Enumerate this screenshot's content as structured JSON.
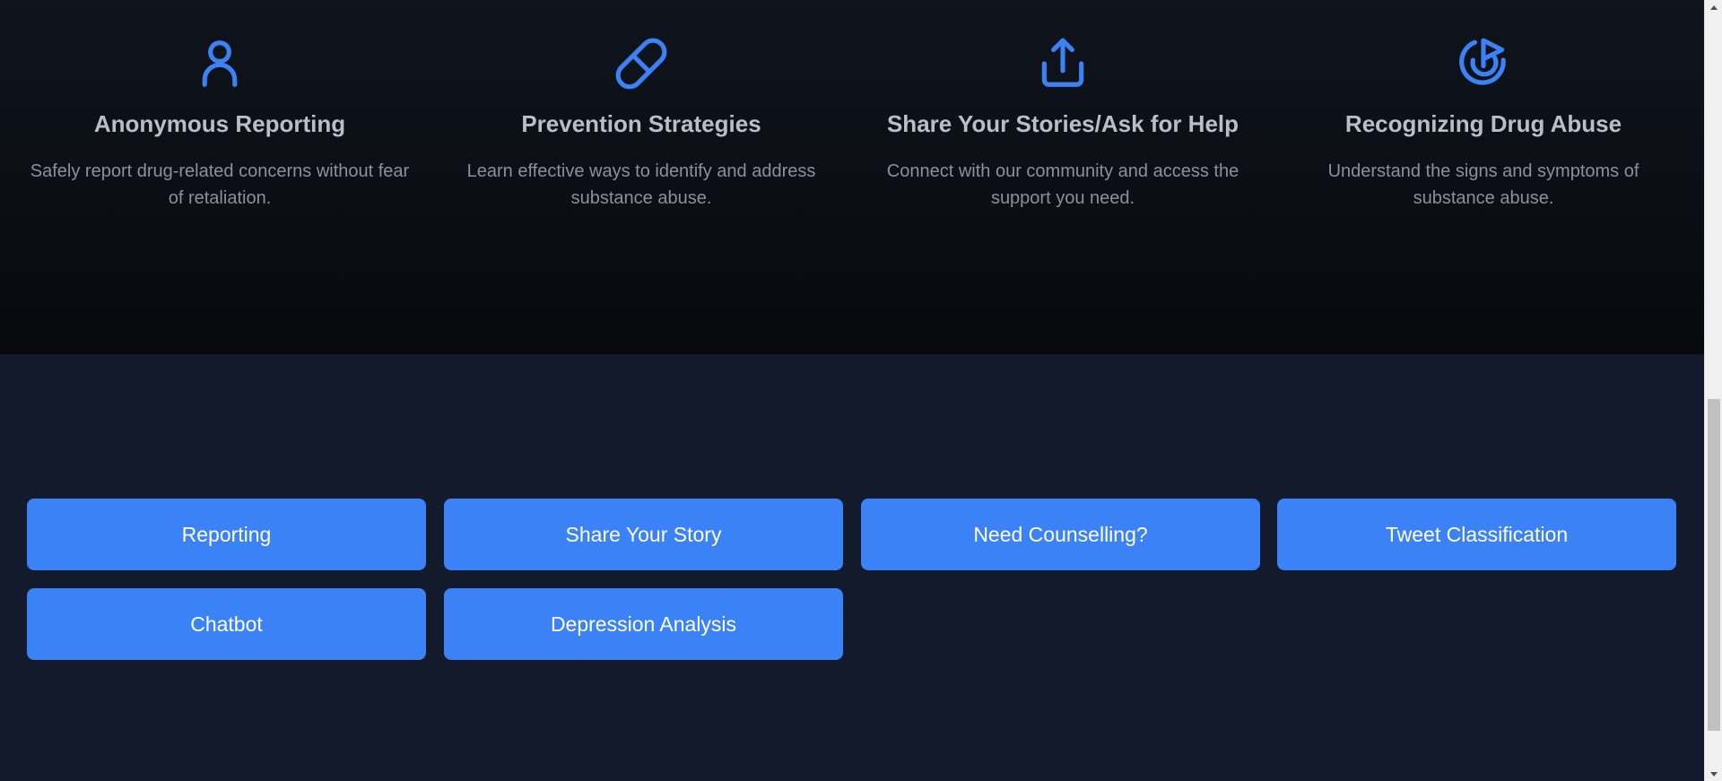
{
  "features": [
    {
      "icon": "user-icon",
      "title": "Anonymous Reporting",
      "description": "Safely report drug-related concerns without fear of retaliation."
    },
    {
      "icon": "pill-icon",
      "title": "Prevention Strategies",
      "description": "Learn effective ways to identify and address substance abuse."
    },
    {
      "icon": "share-icon",
      "title": "Share Your Stories/Ask for Help",
      "description": "Connect with our community and access the support you need."
    },
    {
      "icon": "target-icon",
      "title": "Recognizing Drug Abuse",
      "description": "Understand the signs and symptoms of substance abuse."
    }
  ],
  "actions": {
    "reporting": "Reporting",
    "share_story": "Share Your Story",
    "counselling": "Need Counselling?",
    "tweet_classification": "Tweet Classification",
    "chatbot": "Chatbot",
    "depression_analysis": "Depression Analysis"
  },
  "colors": {
    "accent": "#3b82f6",
    "features_background": "#0b0e14",
    "actions_background": "#121a2b",
    "title_text": "#b9bec7",
    "body_text": "#8a919c"
  }
}
